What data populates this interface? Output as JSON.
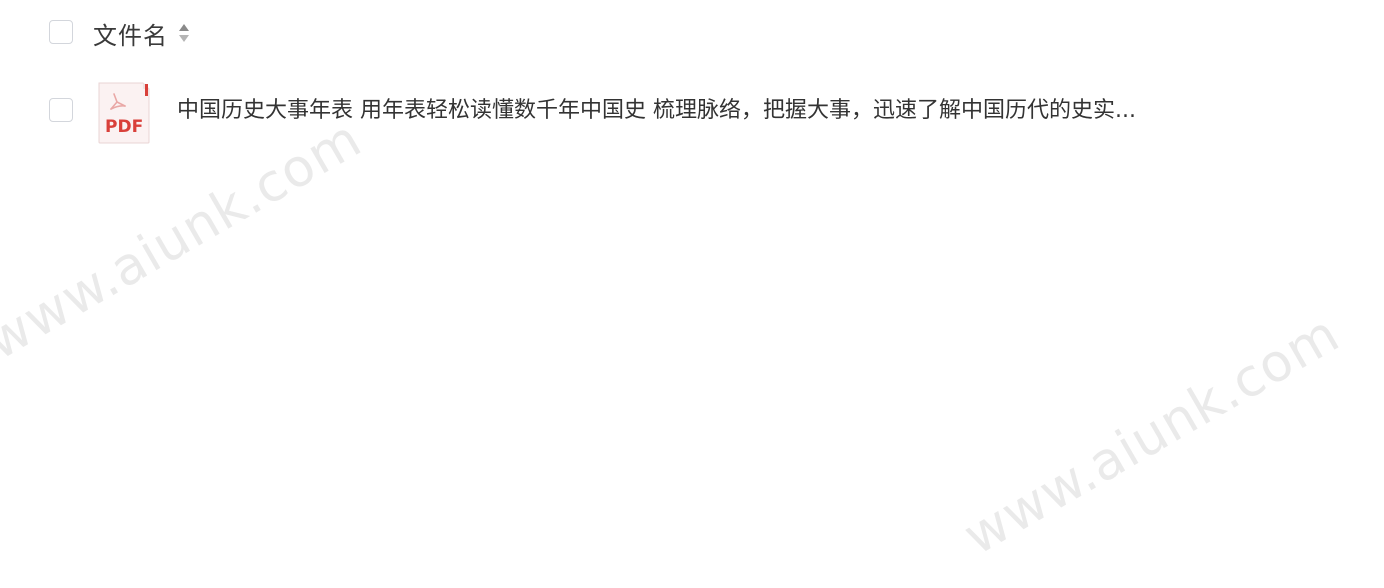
{
  "table": {
    "header": {
      "column_label": "文件名",
      "sort_icon": "sort-icon"
    },
    "rows": [
      {
        "file_type_icon": "pdf-file-icon",
        "icon_label": "PDF",
        "name": "中国历史大事年表 用年表轻松读懂数千年中国史 梳理脉络，把握大事，迅速了解中国历代的史实..."
      }
    ]
  },
  "watermark": {
    "text": "www.aiunk.com"
  },
  "colors": {
    "pdf_red": "#d9403a",
    "checkbox_border": "#d3d6dc",
    "text": "#333333",
    "watermark": "#d9d9d9"
  }
}
